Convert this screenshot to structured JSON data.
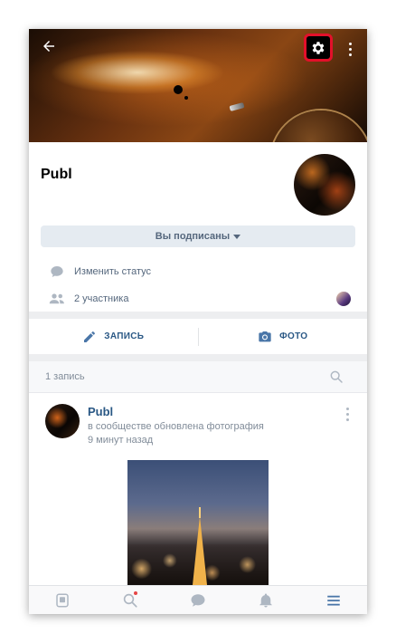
{
  "community": {
    "name": "Publ",
    "subscribe_label": "Вы подписаны",
    "status_label": "Изменить статус",
    "members_label": "2 участника"
  },
  "actions": {
    "post_label": "ЗАПИСЬ",
    "photo_label": "ФОТО"
  },
  "feed": {
    "count_label": "1 запись"
  },
  "post": {
    "author": "Publ",
    "description": "в сообществе обновлена фотография",
    "time": "9 минут назад"
  },
  "icons": {
    "back": "back-arrow-icon",
    "settings": "gear-icon",
    "more": "more-vertical-icon",
    "status": "chat-bubble-icon",
    "members": "people-icon",
    "post": "pencil-icon",
    "photo": "camera-icon",
    "search": "search-icon",
    "tabs": [
      "news-icon",
      "discover-icon",
      "messages-icon",
      "notifications-icon",
      "menu-icon"
    ]
  },
  "colors": {
    "accent": "#2a5885",
    "highlight": "#e3102a",
    "notification_dot": "#e64646",
    "active_tab": "#4a76a8"
  }
}
